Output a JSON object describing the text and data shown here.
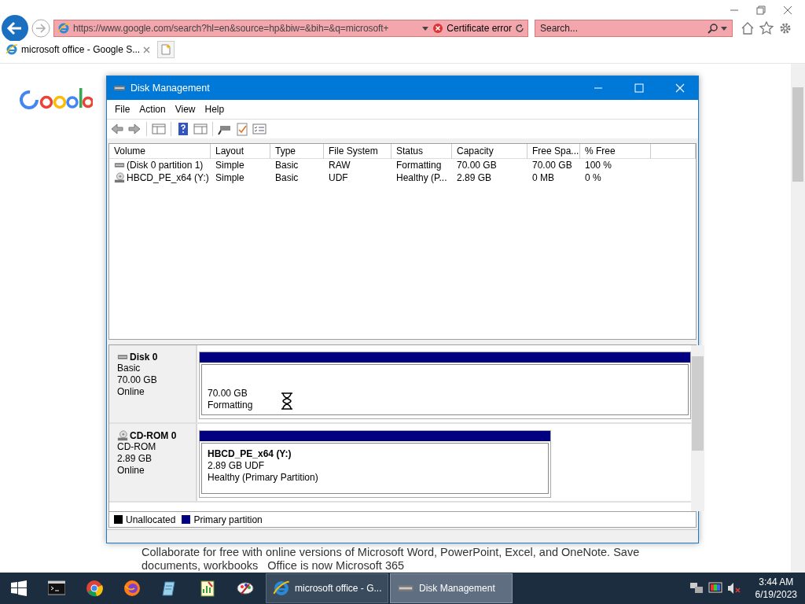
{
  "browser": {
    "address": "https://www.google.com/search?hl=en&source=hp&biw=&bih=&q=microsoft+",
    "certificate_error": "Certificate error",
    "search_placeholder": "Search...",
    "tabs": [
      {
        "title": "microsoft office - Google S...",
        "selected": true
      }
    ]
  },
  "page": {
    "lines": [
      "Collaborate for free with online versions of Microsoft Word, PowerPoint, Excel, and OneNote. Save",
      [
        "documents, workbooks",
        "Office is now Microsoft 365"
      ]
    ]
  },
  "window": {
    "title": "Disk Management",
    "menu": [
      "File",
      "Action",
      "View",
      "Help"
    ],
    "volumes": {
      "columns": [
        "Volume",
        "Layout",
        "Type",
        "File System",
        "Status",
        "Capacity",
        "Free Spa...",
        "% Free"
      ],
      "rows": [
        {
          "kind": "disk",
          "cells": [
            "(Disk 0 partition 1)",
            "Simple",
            "Basic",
            "RAW",
            "Formatting",
            "70.00 GB",
            "70.00 GB",
            "100 %"
          ]
        },
        {
          "kind": "cdrom",
          "cells": [
            "HBCD_PE_x64 (Y:)",
            "Simple",
            "Basic",
            "UDF",
            "Healthy (P...",
            "2.89 GB",
            "0 MB",
            "0 %"
          ]
        }
      ]
    },
    "disks": [
      {
        "kind": "disk",
        "name": "Disk 0",
        "lines": [
          "Basic",
          "70.00 GB",
          "Online"
        ],
        "partition": {
          "lines": [
            "70.00 GB",
            "Formatting"
          ]
        }
      },
      {
        "kind": "cdrom",
        "name": "CD-ROM 0",
        "lines": [
          "CD-ROM",
          "2.89 GB",
          "Online"
        ],
        "partition": {
          "title": "HBCD_PE_x64  (Y:)",
          "lines": [
            "2.89 GB UDF",
            "Healthy (Primary Partition)"
          ]
        }
      }
    ],
    "legend": [
      {
        "label": "Unallocated",
        "color": "#000000"
      },
      {
        "label": "Primary partition",
        "color": "#000080"
      }
    ]
  },
  "taskbar": {
    "apps": [
      {
        "kind": "cmd"
      },
      {
        "kind": "chrome"
      },
      {
        "kind": "firefox"
      },
      {
        "kind": "notes"
      },
      {
        "kind": "sheet"
      },
      {
        "kind": "paint"
      }
    ],
    "windows": [
      {
        "kind": "ie",
        "title": "microsoft office - G...",
        "selected": false
      },
      {
        "kind": "disk",
        "title": "Disk Management",
        "selected": true
      }
    ],
    "time": "3:44 AM",
    "date": "6/19/2023"
  }
}
